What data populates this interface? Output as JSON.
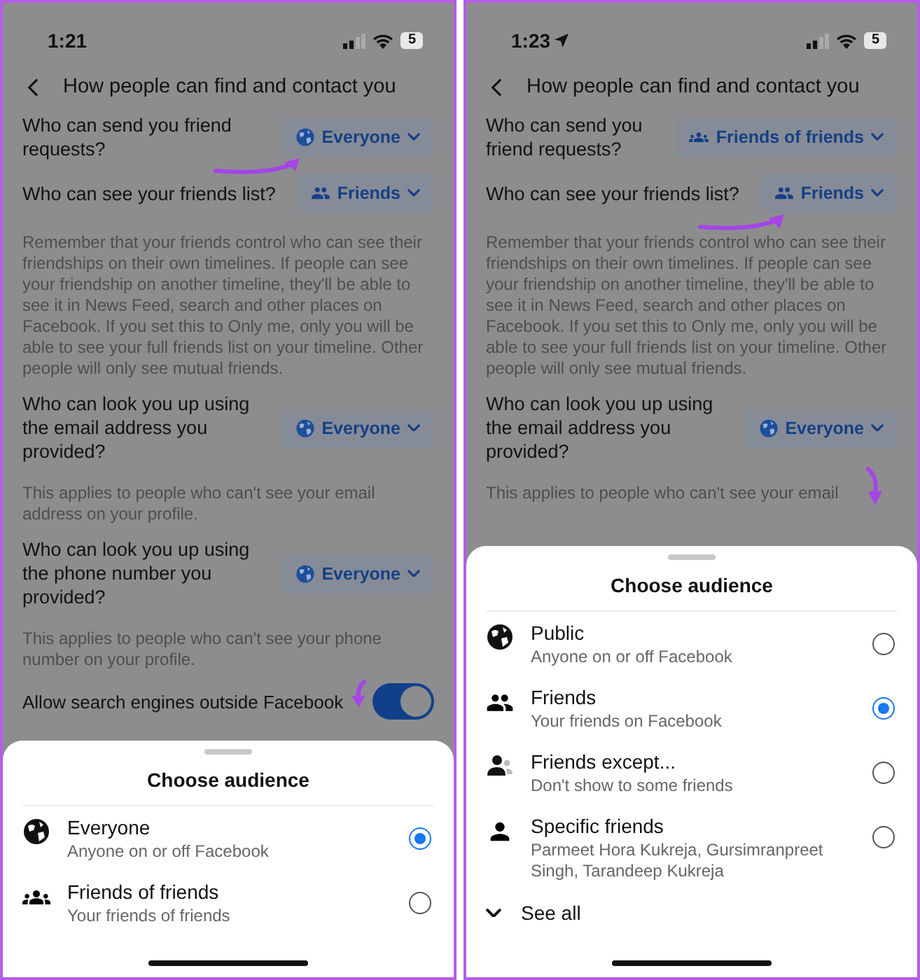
{
  "screens": [
    {
      "status_bar": {
        "time": "1:21",
        "location": false,
        "battery": "5"
      },
      "header": {
        "title": "How people can find and contact you"
      },
      "settings": [
        {
          "kind": "select",
          "question": "Who can send you friend requests?",
          "value": {
            "kind": "globe",
            "label": "Everyone"
          }
        },
        {
          "kind": "select",
          "question": "Who can see your friends list?",
          "value": {
            "kind": "friends",
            "label": "Friends"
          },
          "description": "Remember that your friends control who can see their friendships on their own timelines. If people can see your friendship on another timeline, they'll be able to see it in News Feed, search and other places on Facebook. If you set this to Only me, only you will be able to see your full friends list on your timeline. Other people will only see mutual friends."
        },
        {
          "kind": "select",
          "question": "Who can look you up using the email address you provided?",
          "value": {
            "kind": "globe",
            "label": "Everyone"
          },
          "description": "This applies to people who can't see your email address on your profile."
        },
        {
          "kind": "select",
          "question": "Who can look you up using the phone number you provided?",
          "value": {
            "kind": "globe",
            "label": "Everyone"
          },
          "description": "This applies to people who can't see your phone number on your profile."
        },
        {
          "kind": "toggle",
          "question": "Allow search engines outside Facebook",
          "on": true
        }
      ],
      "sheet": {
        "title": "Choose audience",
        "options": [
          {
            "kind": "globe",
            "label": "Everyone",
            "description": "Anyone on or off Facebook",
            "selected": true
          },
          {
            "kind": "group",
            "label": "Friends of friends",
            "description": "Your friends of friends",
            "selected": false
          }
        ]
      }
    },
    {
      "status_bar": {
        "time": "1:23",
        "location": true,
        "battery": "5"
      },
      "header": {
        "title": "How people can find and contact you"
      },
      "settings": [
        {
          "kind": "select",
          "question": "Who can send you friend requests?",
          "value": {
            "kind": "group",
            "label": "Friends of friends"
          }
        },
        {
          "kind": "select",
          "question": "Who can see your friends list?",
          "value": {
            "kind": "friends",
            "label": "Friends"
          },
          "description": "Remember that your friends control who can see their friendships on their own timelines. If people can see your friendship on another timeline, they'll be able to see it in News Feed, search and other places on Facebook. If you set this to Only me, only you will be able to see your full friends list on your timeline. Other people will only see mutual friends."
        },
        {
          "kind": "select",
          "question": "Who can look you up using the email address you provided?",
          "value": {
            "kind": "globe",
            "label": "Everyone"
          },
          "description": "This applies to people who can't see your email"
        }
      ],
      "sheet": {
        "title": "Choose audience",
        "options": [
          {
            "kind": "globe",
            "label": "Public",
            "description": "Anyone on or off Facebook",
            "selected": false
          },
          {
            "kind": "friends",
            "label": "Friends",
            "description": "Your friends on Facebook",
            "selected": true
          },
          {
            "kind": "except",
            "label": "Friends except...",
            "description": "Don't show to some friends",
            "selected": false
          },
          {
            "kind": "person",
            "label": "Specific friends",
            "description": "Parmeet Hora Kukreja, Gursimranpreet Singh, Tarandeep Kukreja",
            "selected": false
          }
        ],
        "see_all": "See all"
      }
    }
  ]
}
